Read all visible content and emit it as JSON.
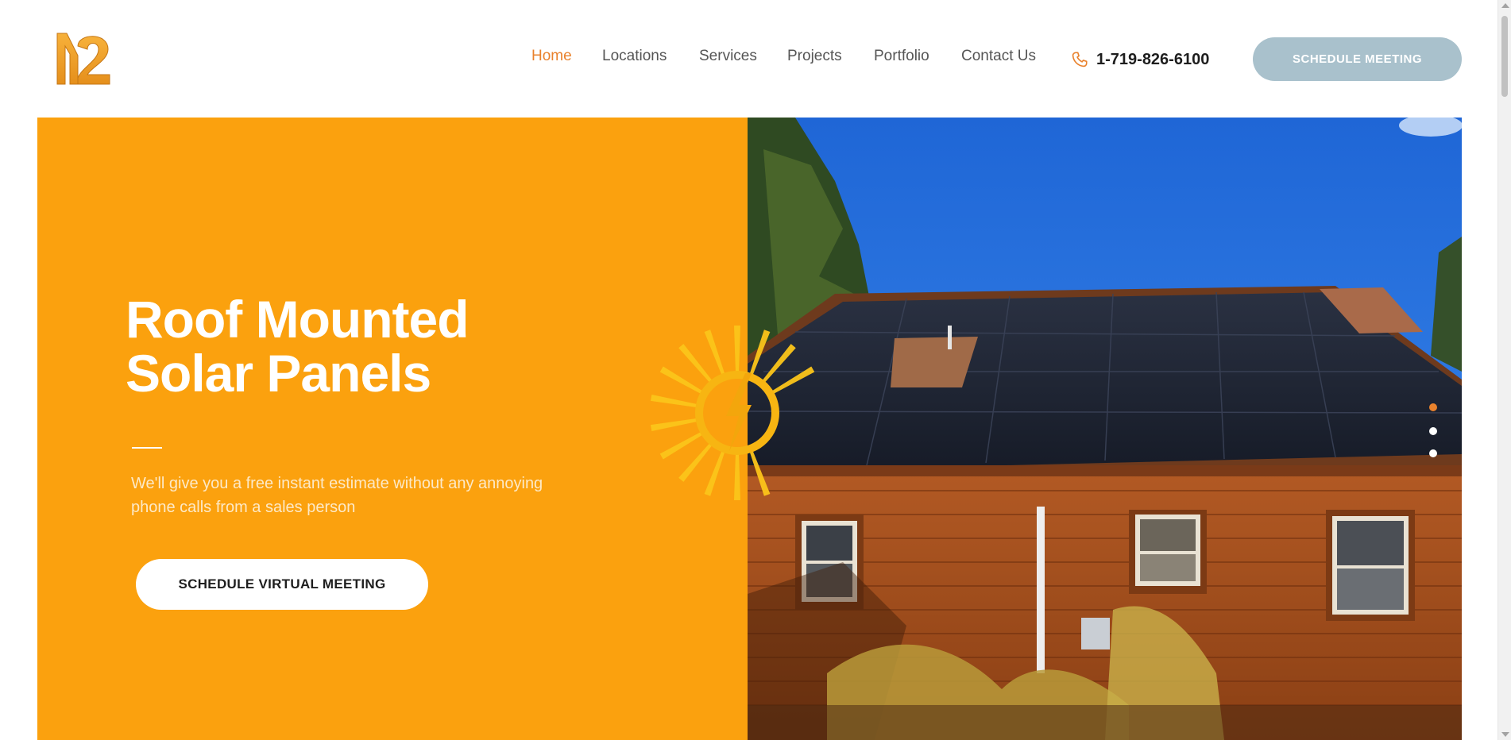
{
  "brand": {
    "logo_icon": "m2-logo-icon",
    "accent_color": "#e9822d"
  },
  "nav": {
    "items": [
      {
        "label": "Home",
        "active": true
      },
      {
        "label": "Locations",
        "active": false
      },
      {
        "label": "Services",
        "active": false
      },
      {
        "label": "Projects",
        "active": false
      },
      {
        "label": "Portfolio",
        "active": false
      },
      {
        "label": "Contact Us",
        "active": false
      }
    ],
    "phone": "1-719-826-6100",
    "phone_icon": "phone-icon",
    "cta_label": "SCHEDULE MEETING"
  },
  "hero": {
    "title_line1": "Roof Mounted",
    "title_line2": "Solar Panels",
    "subtitle": "We'll give you a free instant estimate without any annoying phone calls from a sales person",
    "cta_label": "SCHEDULE VIRTUAL MEETING",
    "background_color": "#fba10e",
    "image_icon": "solar-roof-photo",
    "slider": {
      "total": 3,
      "active_index": 0
    }
  }
}
